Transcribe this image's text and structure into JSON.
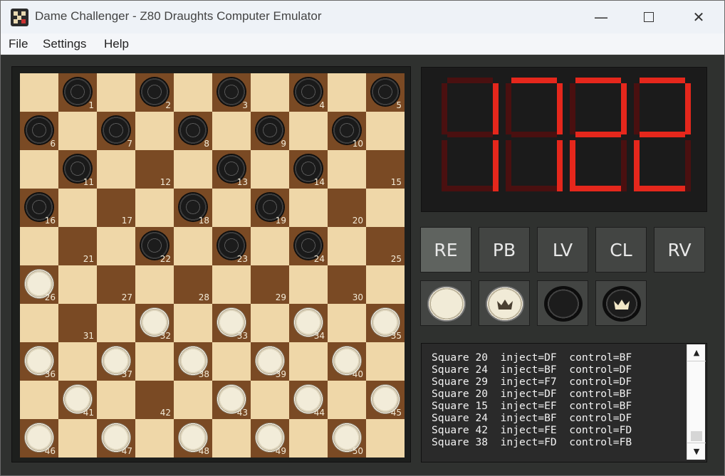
{
  "window": {
    "title": "Dame Challenger - Z80 Draughts Computer Emulator"
  },
  "menu": [
    "File",
    "Settings",
    "Help"
  ],
  "board": {
    "pieces": {
      "black": [
        1,
        2,
        3,
        4,
        5,
        6,
        7,
        8,
        9,
        10,
        11,
        13,
        14,
        16,
        18,
        19,
        22,
        23,
        24
      ],
      "white": [
        26,
        32,
        33,
        34,
        35,
        36,
        37,
        38,
        39,
        40,
        41,
        43,
        44,
        45,
        46,
        47,
        48,
        49,
        50
      ]
    }
  },
  "display": {
    "digits": [
      [
        "b",
        "c"
      ],
      [
        "a",
        "b",
        "c"
      ],
      [
        "a",
        "b",
        "g",
        "e",
        "d"
      ],
      [
        "a",
        "b",
        "g",
        "e",
        "d"
      ]
    ],
    "on_color": "#e5271c",
    "off_color": "#4a1010"
  },
  "buttons": [
    "RE",
    "PB",
    "LV",
    "CL",
    "RV"
  ],
  "active_button": "RE",
  "piece_buttons": [
    "white-man",
    "white-king",
    "black-man",
    "black-king"
  ],
  "log": [
    "Square 20  inject=DF  control=BF",
    "Square 24  inject=BF  control=DF",
    "Square 29  inject=F7  control=DF",
    "Square 20  inject=DF  control=BF",
    "Square 15  inject=EF  control=BF",
    "Square 24  inject=BF  control=DF",
    "Square 42  inject=FE  control=FD",
    "Square 38  inject=FD  control=FB"
  ]
}
